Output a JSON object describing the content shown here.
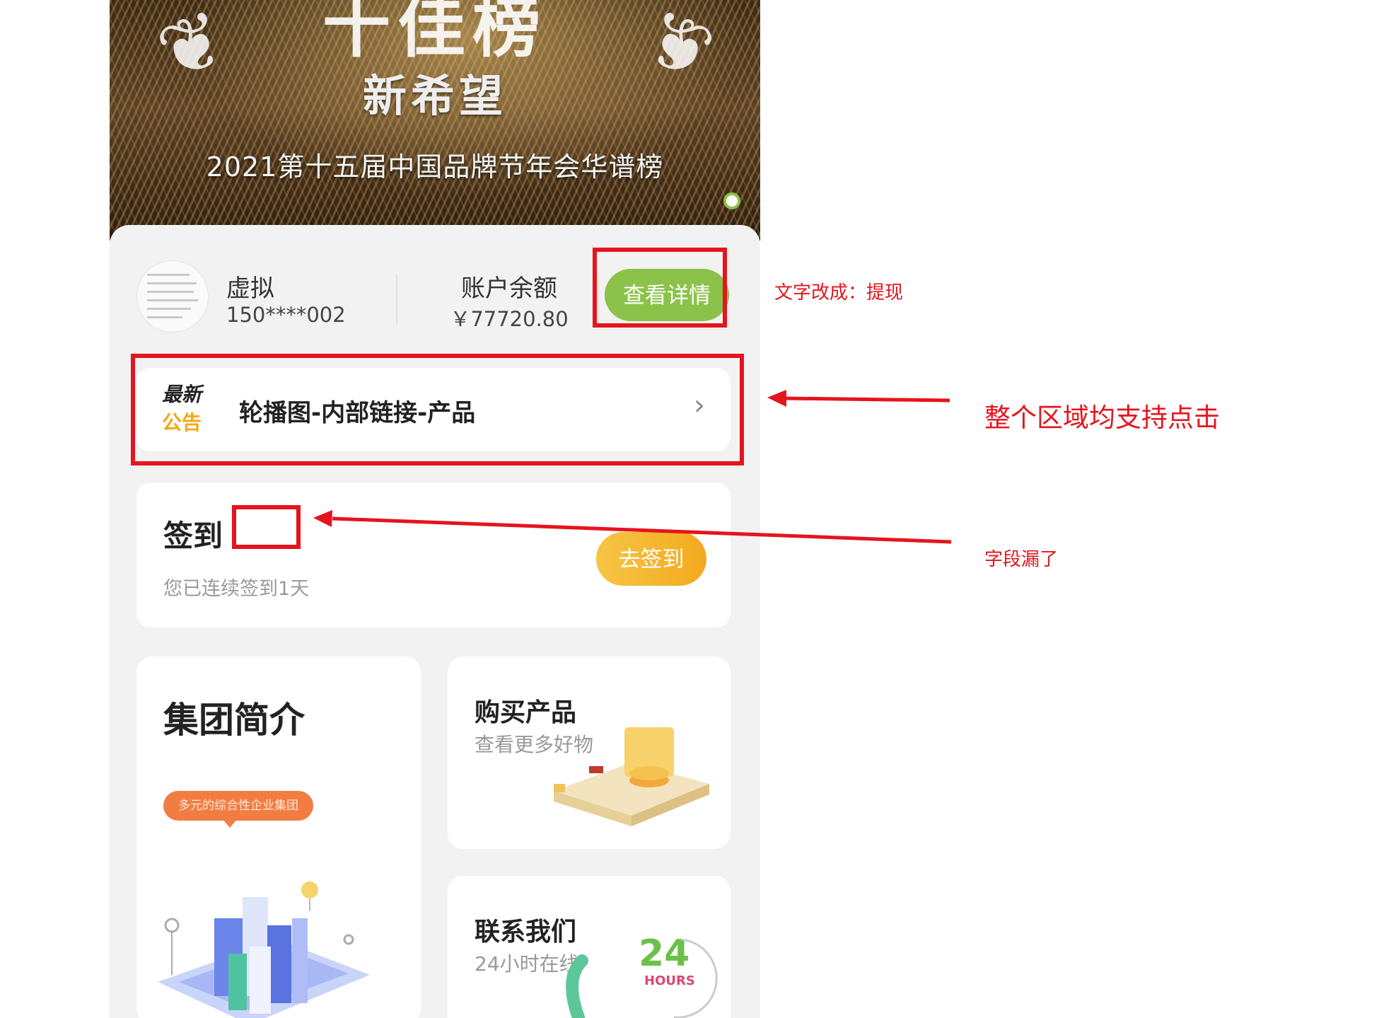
{
  "banner": {
    "top_text": "十佳榜",
    "title": "新希望",
    "subtitle": "2021第十五届中国品牌节年会华谱榜"
  },
  "account": {
    "name": "虚拟",
    "phone": "150****002",
    "balance_label": "账户余额",
    "balance_value": "￥77720.80",
    "detail_button": "查看详情"
  },
  "notice": {
    "badge_line1": "最新",
    "badge_line2": "公告",
    "text": "轮播图-内部链接-产品",
    "arrow": "›"
  },
  "checkin": {
    "title": "签到",
    "subtitle": "您已连续签到1天",
    "button": "去签到"
  },
  "cards": {
    "intro_title": "集团简介",
    "intro_bubble": "多元的综合性企业集团",
    "buy_title": "购买产品",
    "buy_sub": "查看更多好物",
    "contact_title": "联系我们",
    "contact_sub": "24小时在线",
    "hours_num": "24",
    "hours_label": "HOURS"
  },
  "annotations": {
    "note_button": "文字改成：提现",
    "note_notice": "整个区域均支持点击",
    "note_checkin": "字段漏了"
  },
  "colors": {
    "annotation_red": "#e5141d",
    "primary_green": "#8bc34a",
    "checkin_orange": "#f3a91e"
  }
}
